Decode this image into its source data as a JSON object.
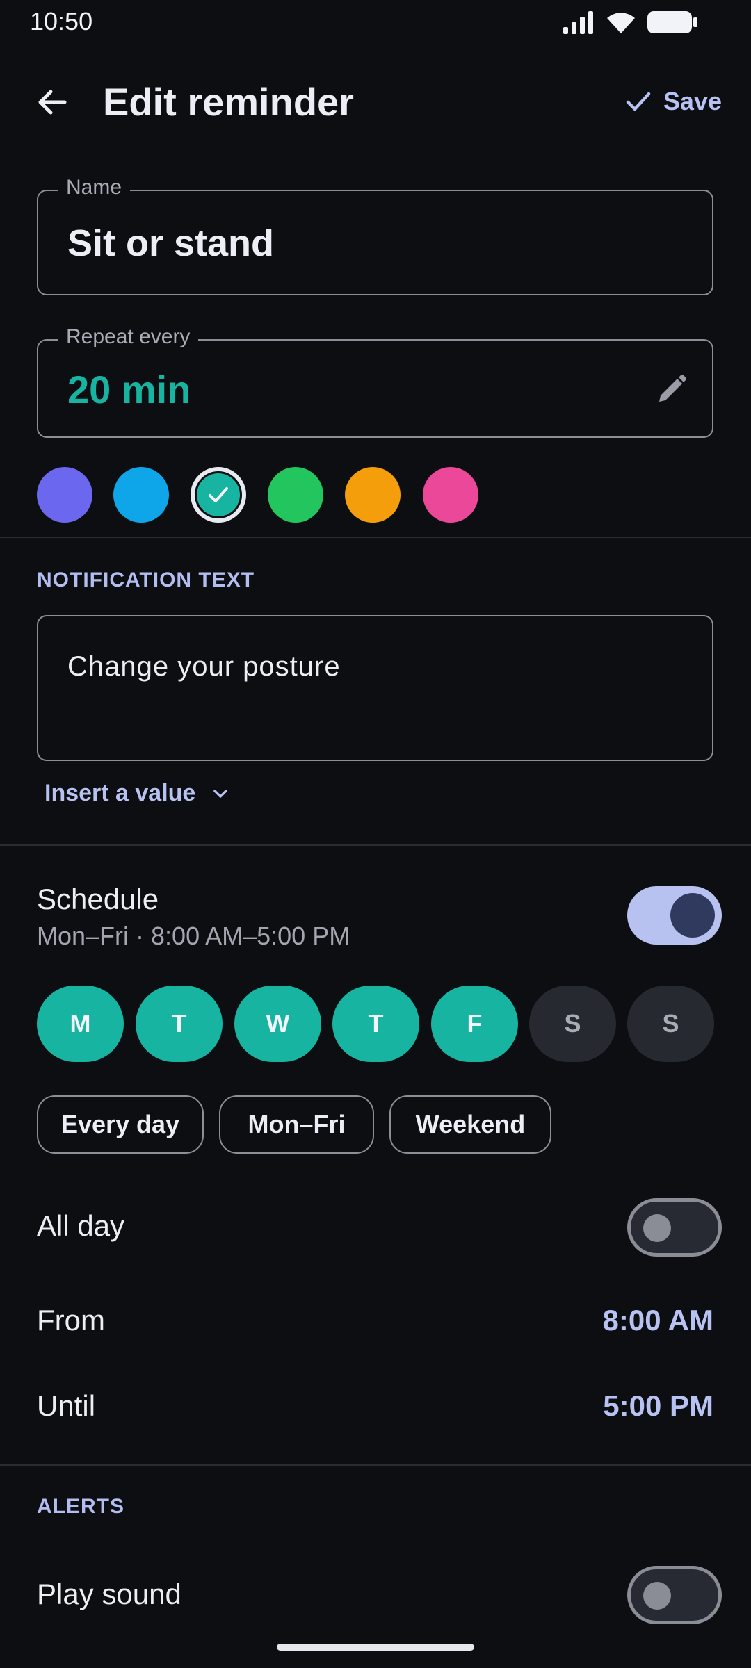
{
  "status_bar": {
    "time": "10:50",
    "icons": [
      "signal-icon",
      "wifi-icon",
      "battery-icon"
    ]
  },
  "appbar": {
    "title": "Edit reminder",
    "save_label": "Save"
  },
  "name_field": {
    "label": "Name",
    "value": "Sit or stand"
  },
  "repeat_field": {
    "label": "Repeat every",
    "value": "20 min"
  },
  "colors": [
    {
      "name": "indigo",
      "hex": "#6b67ee",
      "selected": false
    },
    {
      "name": "sky",
      "hex": "#0ea5e9",
      "selected": false
    },
    {
      "name": "teal",
      "hex": "#17b5a1",
      "selected": true
    },
    {
      "name": "green",
      "hex": "#22c55e",
      "selected": false
    },
    {
      "name": "amber",
      "hex": "#f59e0b",
      "selected": false
    },
    {
      "name": "pink",
      "hex": "#ec4899",
      "selected": false
    }
  ],
  "notification": {
    "section_title": "NOTIFICATION TEXT",
    "text": "Change your posture",
    "insert_label": "Insert a value"
  },
  "schedule": {
    "label": "Schedule",
    "summary": "Mon–Fri · 8:00 AM–5:00 PM",
    "enabled": true,
    "days": [
      {
        "letter": "M",
        "on": true
      },
      {
        "letter": "T",
        "on": true
      },
      {
        "letter": "W",
        "on": true
      },
      {
        "letter": "T",
        "on": true
      },
      {
        "letter": "F",
        "on": true
      },
      {
        "letter": "S",
        "on": false
      },
      {
        "letter": "S",
        "on": false
      }
    ],
    "presets": [
      "Every day",
      "Mon–Fri",
      "Weekend"
    ],
    "all_day_label": "All day",
    "all_day": false,
    "from_label": "From",
    "from_value": "8:00 AM",
    "until_label": "Until",
    "until_value": "5:00 PM"
  },
  "alerts": {
    "section_title": "ALERTS",
    "play_sound_label": "Play sound",
    "play_sound": false
  },
  "theme": {
    "accent": "#17b5a1",
    "primary_light": "#b8c2f2",
    "background": "#0d0e12"
  }
}
